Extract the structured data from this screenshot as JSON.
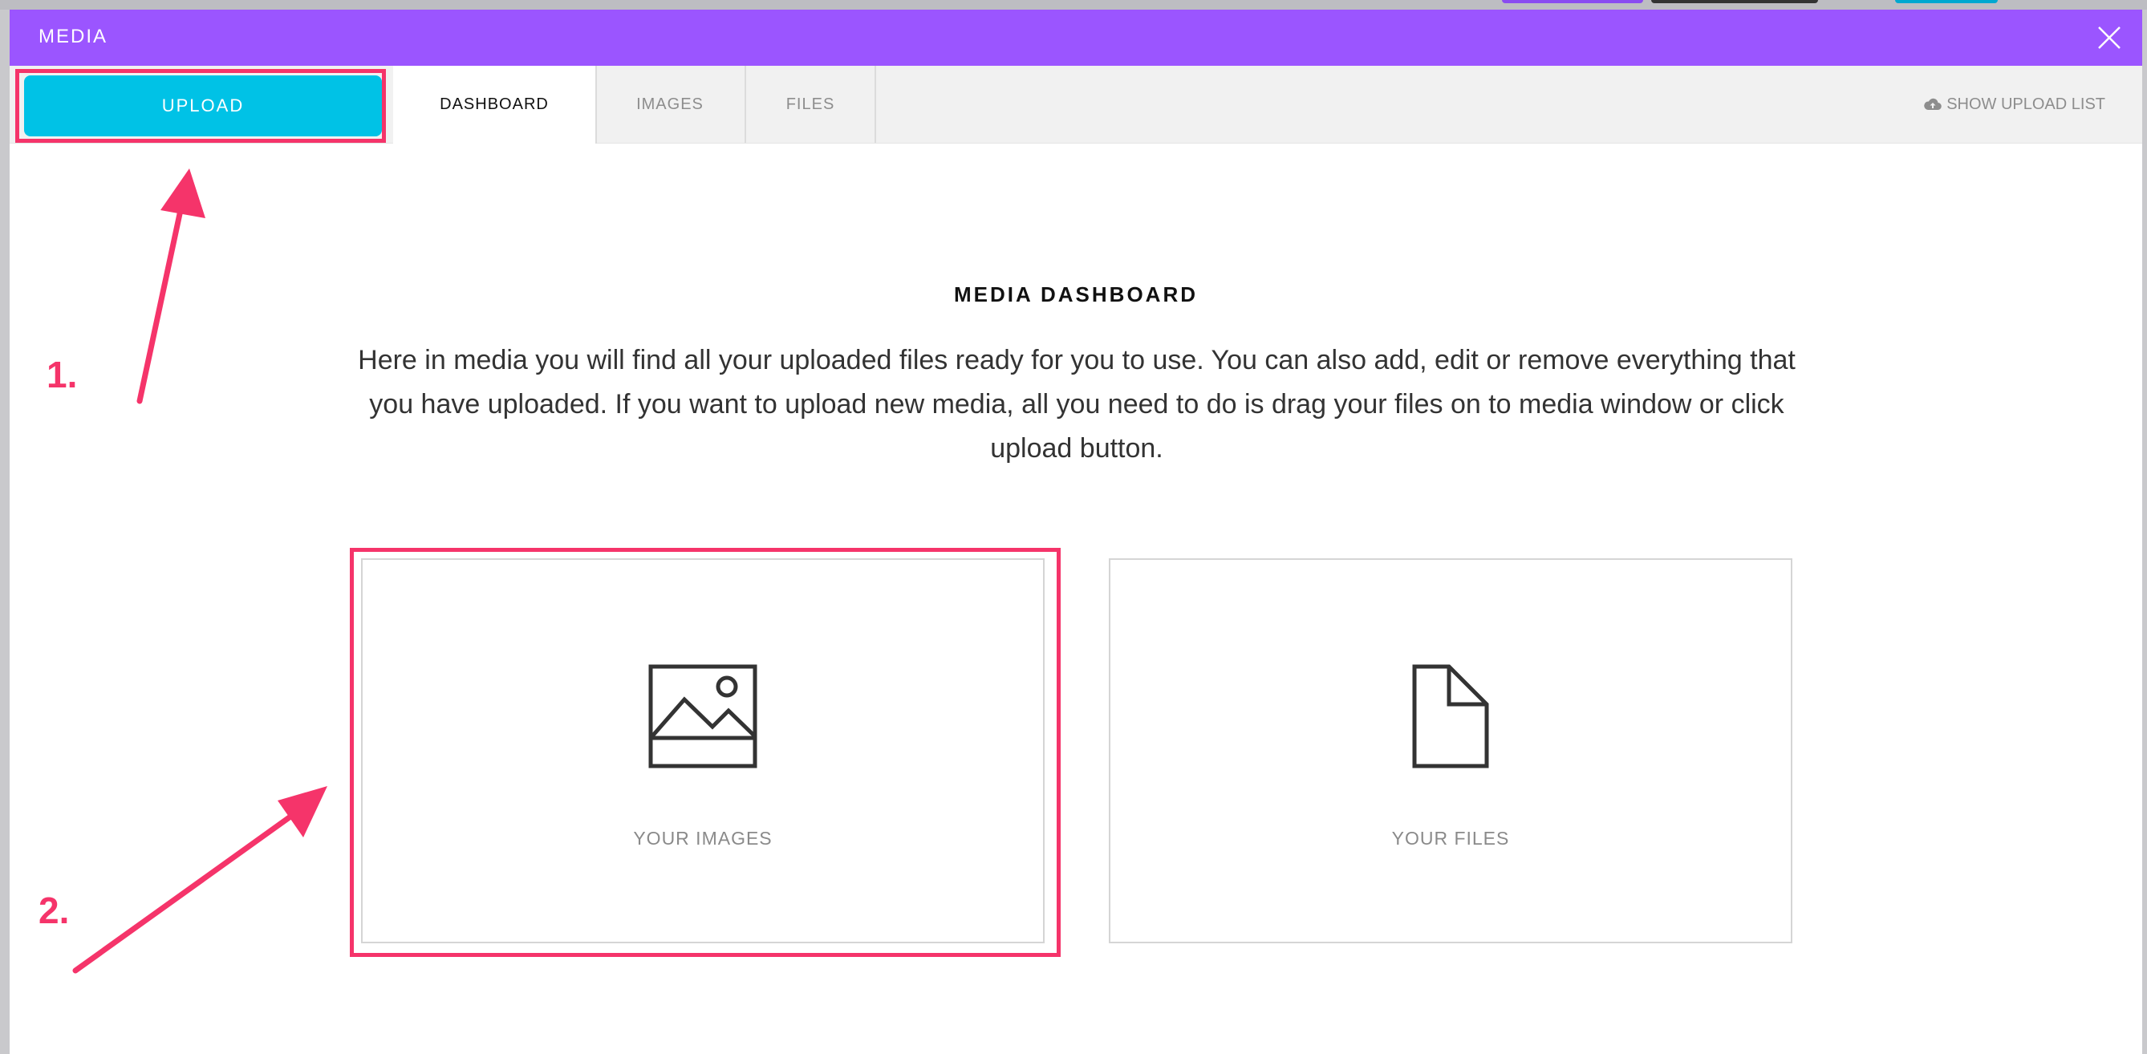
{
  "window": {
    "title": "MEDIA",
    "close_icon": "close-icon"
  },
  "toolbar": {
    "upload_label": "UPLOAD",
    "tabs": [
      {
        "label": "DASHBOARD",
        "active": true
      },
      {
        "label": "IMAGES",
        "active": false
      },
      {
        "label": "FILES",
        "active": false
      }
    ],
    "show_upload_list": "SHOW UPLOAD LIST",
    "show_upload_icon": "cloud-upload-icon"
  },
  "dashboard": {
    "title": "MEDIA DASHBOARD",
    "description": "Here in media you will find all your uploaded files ready for you to use. You can also add, edit or remove everything that you have uploaded. If you want to upload new media, all you need to do is drag your files on to media window or click upload button.",
    "cards": [
      {
        "label": "YOUR IMAGES",
        "icon": "image-icon"
      },
      {
        "label": "YOUR FILES",
        "icon": "file-icon"
      }
    ]
  },
  "annotations": {
    "step1": "1.",
    "step2": "2."
  },
  "colors": {
    "titlebar": "#9b55ff",
    "upload_button": "#00c2e6",
    "annotation": "#f5346a"
  }
}
